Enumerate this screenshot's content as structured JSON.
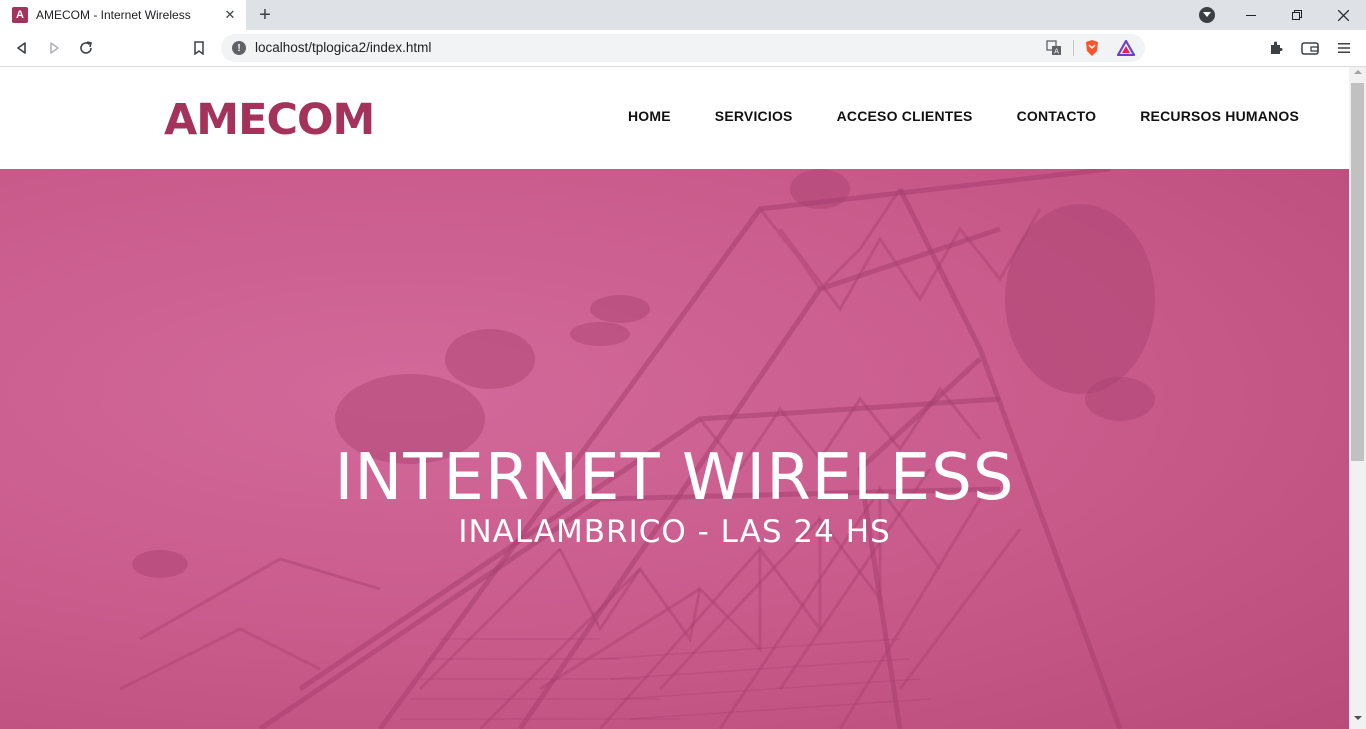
{
  "browser": {
    "tab_title": "AMECOM - Internet Wireless",
    "favicon_letter": "A",
    "url": "localhost/tplogica2/index.html",
    "icons": [
      "back-icon",
      "forward-icon",
      "reload-icon",
      "bookmark-icon",
      "info-icon",
      "translate-icon",
      "brave-shields-icon",
      "brave-rewards-icon",
      "extensions-icon",
      "wallet-icon",
      "menu-icon"
    ]
  },
  "site": {
    "logo": "AMECOM",
    "brand_color": "#a3335a",
    "nav": {
      "home": "HOME",
      "servicios": "SERVICIOS",
      "acceso": "ACCESO CLIENTES",
      "contacto": "CONTACTO",
      "rrhh": "RECURSOS HUMANOS"
    },
    "hero": {
      "title": "INTERNET WIRELESS",
      "subtitle": "INALAMBRICO - LAS 24 HS",
      "overlay_color": "#c85a8a"
    }
  }
}
